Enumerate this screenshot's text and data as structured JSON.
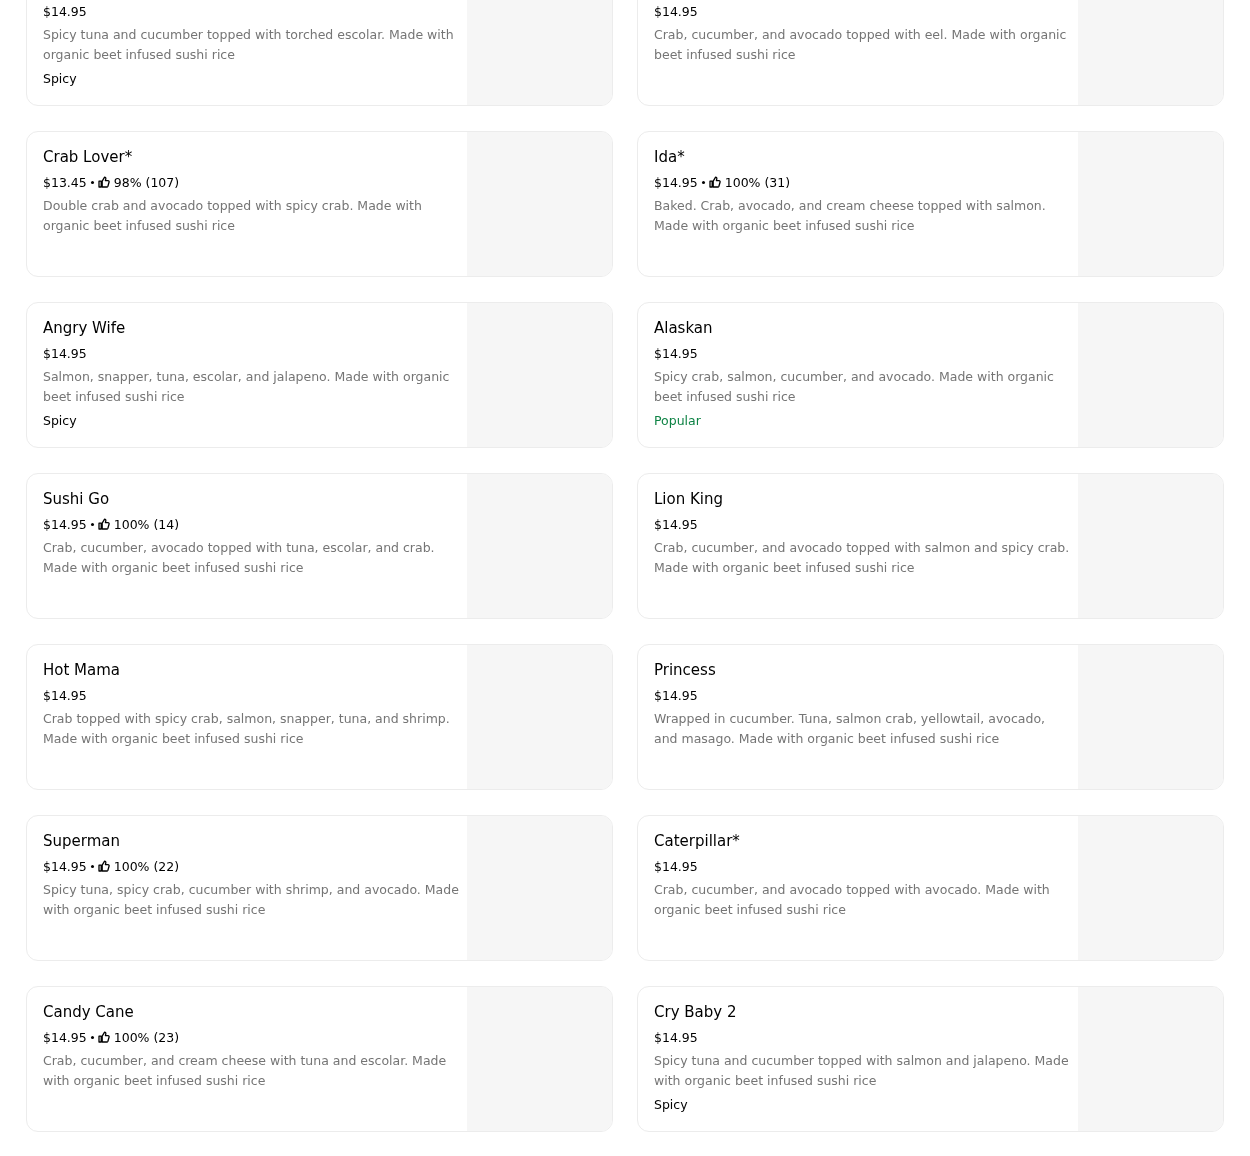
{
  "items": [
    {
      "price": "$14.95",
      "description": "Spicy tuna and cucumber topped with torched escolar. Made with organic beet infused sushi rice",
      "tag": {
        "text": "Spicy",
        "kind": "spicy"
      }
    },
    {
      "price": "$14.95",
      "description": "Crab, cucumber, and avocado topped with eel. Made with organic beet infused sushi rice"
    },
    {
      "name": "Crab Lover*",
      "price": "$13.45",
      "rating": "98% (107)",
      "description": "Double crab and avocado topped with spicy crab. Made with organic beet infused sushi rice"
    },
    {
      "name": "Ida*",
      "price": "$14.95",
      "rating": "100% (31)",
      "description": "Baked. Crab, avocado, and cream cheese topped with salmon. Made with organic beet infused sushi rice"
    },
    {
      "name": "Angry Wife",
      "price": "$14.95",
      "description": "Salmon, snapper, tuna, escolar, and jalapeno. Made with organic beet infused sushi rice",
      "tag": {
        "text": "Spicy",
        "kind": "spicy"
      }
    },
    {
      "name": "Alaskan",
      "price": "$14.95",
      "description": "Spicy crab, salmon, cucumber, and avocado. Made with organic beet infused sushi rice",
      "tag": {
        "text": "Popular",
        "kind": "popular"
      }
    },
    {
      "name": "Sushi Go",
      "price": "$14.95",
      "rating": "100% (14)",
      "description": "Crab, cucumber, avocado topped with tuna, escolar, and crab. Made with organic beet infused sushi rice"
    },
    {
      "name": "Lion King",
      "price": "$14.95",
      "description": "Crab, cucumber, and avocado topped with salmon and spicy crab. Made with organic beet infused sushi rice"
    },
    {
      "name": "Hot Mama",
      "price": "$14.95",
      "description": "Crab topped with spicy crab, salmon, snapper, tuna, and shrimp. Made with organic beet infused sushi rice"
    },
    {
      "name": "Princess",
      "price": "$14.95",
      "description": "Wrapped in cucumber. Tuna, salmon crab, yellowtail, avocado, and masago. Made with organic beet infused sushi rice"
    },
    {
      "name": "Superman",
      "price": "$14.95",
      "rating": "100% (22)",
      "description": "Spicy tuna, spicy crab, cucumber with shrimp, and avocado. Made with organic beet infused sushi rice"
    },
    {
      "name": "Caterpillar*",
      "price": "$14.95",
      "description": "Crab, cucumber, and avocado topped with avocado. Made with organic beet infused sushi rice"
    },
    {
      "name": "Candy Cane",
      "price": "$14.95",
      "rating": "100% (23)",
      "description": "Crab, cucumber, and cream cheese with tuna and escolar. Made with organic beet infused sushi rice"
    },
    {
      "name": "Cry Baby 2",
      "price": "$14.95",
      "description": "Spicy tuna and cucumber topped with salmon and jalapeno. Made with organic beet infused sushi rice",
      "tag": {
        "text": "Spicy",
        "kind": "spicy"
      }
    }
  ]
}
